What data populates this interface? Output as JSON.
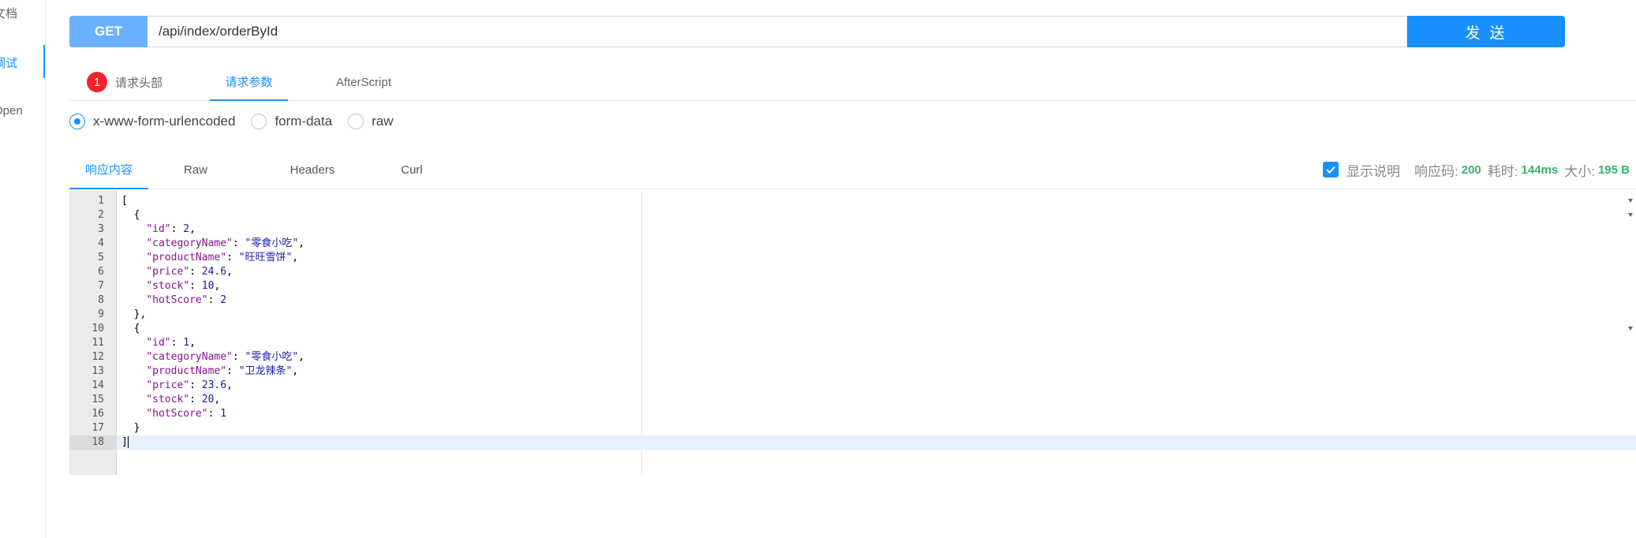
{
  "sidebar": {
    "items": [
      {
        "label": "文档",
        "active": false
      },
      {
        "label": "调试",
        "active": true
      },
      {
        "label": "Open",
        "active": false
      }
    ]
  },
  "request": {
    "method": "GET",
    "url": "/api/index/orderById",
    "send_label": "发 送"
  },
  "request_tabs": [
    {
      "label": "请求头部",
      "badge": "1",
      "active": false
    },
    {
      "label": "请求参数",
      "active": true
    },
    {
      "label": "AfterScript",
      "active": false
    }
  ],
  "body_types": [
    {
      "label": "x-www-form-urlencoded",
      "checked": true
    },
    {
      "label": "form-data",
      "checked": false
    },
    {
      "label": "raw",
      "checked": false
    }
  ],
  "response_tabs": [
    {
      "label": "响应内容",
      "active": true
    },
    {
      "label": "Raw",
      "active": false
    },
    {
      "label": "Headers",
      "active": false
    },
    {
      "label": "Curl",
      "active": false
    }
  ],
  "response_info": {
    "show_desc_label": "显示说明",
    "show_desc_checked": true,
    "status_label": "响应码:",
    "status_value": "200",
    "time_label": "耗时:",
    "time_value": "144ms",
    "size_label": "大小:",
    "size_value": "195 B"
  },
  "editor": {
    "active_line": 18,
    "lines": [
      {
        "n": "1",
        "fold": true,
        "code": "["
      },
      {
        "n": "2",
        "fold": true,
        "code": "  {"
      },
      {
        "n": "3",
        "code": "    \"id\": 2,"
      },
      {
        "n": "4",
        "code": "    \"categoryName\": \"零食小吃\","
      },
      {
        "n": "5",
        "code": "    \"productName\": \"旺旺雪饼\","
      },
      {
        "n": "6",
        "code": "    \"price\": 24.6,"
      },
      {
        "n": "7",
        "code": "    \"stock\": 10,"
      },
      {
        "n": "8",
        "code": "    \"hotScore\": 2"
      },
      {
        "n": "9",
        "code": "  },"
      },
      {
        "n": "10",
        "fold": true,
        "code": "  {"
      },
      {
        "n": "11",
        "code": "    \"id\": 1,"
      },
      {
        "n": "12",
        "code": "    \"categoryName\": \"零食小吃\","
      },
      {
        "n": "13",
        "code": "    \"productName\": \"卫龙辣条\","
      },
      {
        "n": "14",
        "code": "    \"price\": 23.6,"
      },
      {
        "n": "15",
        "code": "    \"stock\": 20,"
      },
      {
        "n": "16",
        "code": "    \"hotScore\": 1"
      },
      {
        "n": "17",
        "code": "  }"
      },
      {
        "n": "18",
        "code": "]"
      }
    ]
  }
}
